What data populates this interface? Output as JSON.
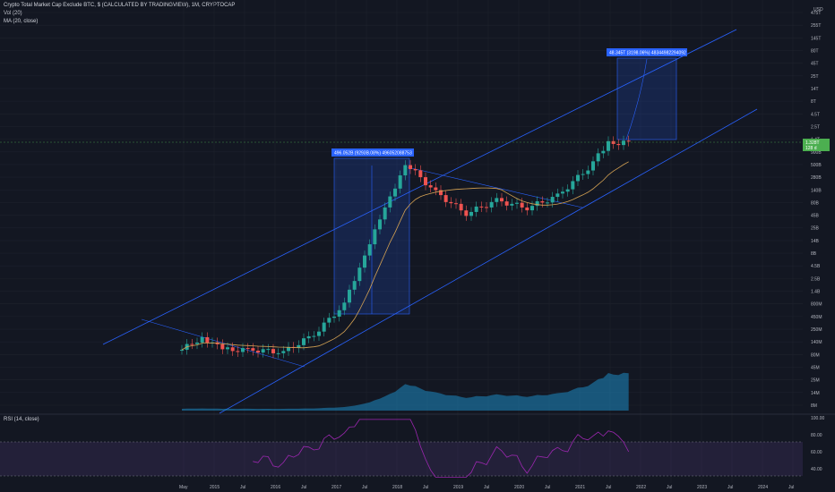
{
  "legend": {
    "title": "Crypto Total Market Cap Exclude BTC, $ (CALCULATED BY TRADINGVIEW), 1M, CRYPTOCAP",
    "vol": "Vol (20)",
    "ma": "MA (20, close)",
    "rsi": "RSI (14, close)"
  },
  "top_right": "USD",
  "price_badge": {
    "value": "1.328T",
    "sub": "128 d"
  },
  "annotations": {
    "measure_2017": "496.052B (9293B.08%) 496052088753",
    "measure_2022": "48.345T (3198.06%) 48344982294092"
  },
  "colors": {
    "background": "#131722",
    "up": "#26a69a",
    "down": "#ef5350",
    "trendline": "#2962ff",
    "ma": "#d5a253",
    "volume": "#1e8bc3",
    "rsi": "#9c27b0",
    "badge": "#4caf50",
    "annotation": "#2962ff"
  },
  "chart_data": {
    "type": "line",
    "title": "Crypto Total Market Cap Exclude BTC, $ (CALCULATED BY TRADINGVIEW), 1M, CRYPTOCAP",
    "scale": "log",
    "price_axis_ticks": [
      "475T",
      "255T",
      "145T",
      "80T",
      "45T",
      "25T",
      "14T",
      "8T",
      "4.5T",
      "2.5T",
      "1.4T",
      "900B",
      "500B",
      "280B",
      "140B",
      "80B",
      "45B",
      "25B",
      "14B",
      "8B",
      "4.5B",
      "2.5B",
      "1.4B",
      "800M",
      "450M",
      "250M",
      "140M",
      "80M",
      "45M",
      "25M",
      "14M",
      "8M"
    ],
    "time_axis_ticks": [
      "May",
      "2015",
      "Jul",
      "2016",
      "Jul",
      "2017",
      "Jul",
      "2018",
      "Jul",
      "2019",
      "Jul",
      "2020",
      "Jul",
      "2021",
      "Jul",
      "2022",
      "Jul",
      "2023",
      "Jul",
      "2024",
      "Jul"
    ],
    "rsi_axis_ticks": [
      "100.00",
      "80.00",
      "60.00",
      "40.00"
    ],
    "ohlc_close_approx": [
      {
        "date": "2014-05",
        "close": 0.1
      },
      {
        "date": "2014-09",
        "close": 0.18
      },
      {
        "date": "2015-01",
        "close": 0.1
      },
      {
        "date": "2015-07",
        "close": 0.1
      },
      {
        "date": "2016-01",
        "close": 0.09
      },
      {
        "date": "2016-07",
        "close": 0.2
      },
      {
        "date": "2017-01",
        "close": 0.8
      },
      {
        "date": "2017-05",
        "close": 8
      },
      {
        "date": "2017-09",
        "close": 60
      },
      {
        "date": "2018-01",
        "close": 500
      },
      {
        "date": "2018-07",
        "close": 130
      },
      {
        "date": "2019-01",
        "close": 50
      },
      {
        "date": "2019-07",
        "close": 90
      },
      {
        "date": "2020-01",
        "close": 65
      },
      {
        "date": "2020-07",
        "close": 110
      },
      {
        "date": "2021-01",
        "close": 400
      },
      {
        "date": "2021-05",
        "close": 1200
      },
      {
        "date": "2021-09",
        "close": 1328
      }
    ],
    "series": [
      {
        "name": "MA (20, close)",
        "values": []
      },
      {
        "name": "Vol (20)",
        "values": []
      },
      {
        "name": "RSI (14, close)",
        "values": []
      }
    ],
    "grid": true,
    "legend_position": "top-left"
  }
}
